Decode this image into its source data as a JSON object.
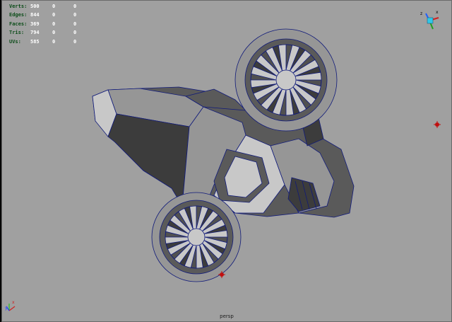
{
  "hud": {
    "rows": [
      {
        "label": "Verts:",
        "values": [
          "500",
          "0",
          "0"
        ]
      },
      {
        "label": "Edges:",
        "values": [
          "844",
          "0",
          "0"
        ]
      },
      {
        "label": "Faces:",
        "values": [
          "369",
          "0",
          "0"
        ]
      },
      {
        "label": "Tris:",
        "values": [
          "794",
          "0",
          "0"
        ]
      },
      {
        "label": "UVs:",
        "values": [
          "585",
          "0",
          "0"
        ]
      }
    ]
  },
  "camera_label": "persp",
  "axes": {
    "top_right": {
      "z": "z",
      "x": "x"
    },
    "bottom_left": {
      "y": "y",
      "z": "z",
      "x": "x"
    }
  },
  "colors": {
    "viewport_bg": "#a0a0a0",
    "wireframe": "#101a7a",
    "hud_label": "#0d4d1a",
    "hud_value": "#ffffff",
    "locator": "#c01010"
  }
}
